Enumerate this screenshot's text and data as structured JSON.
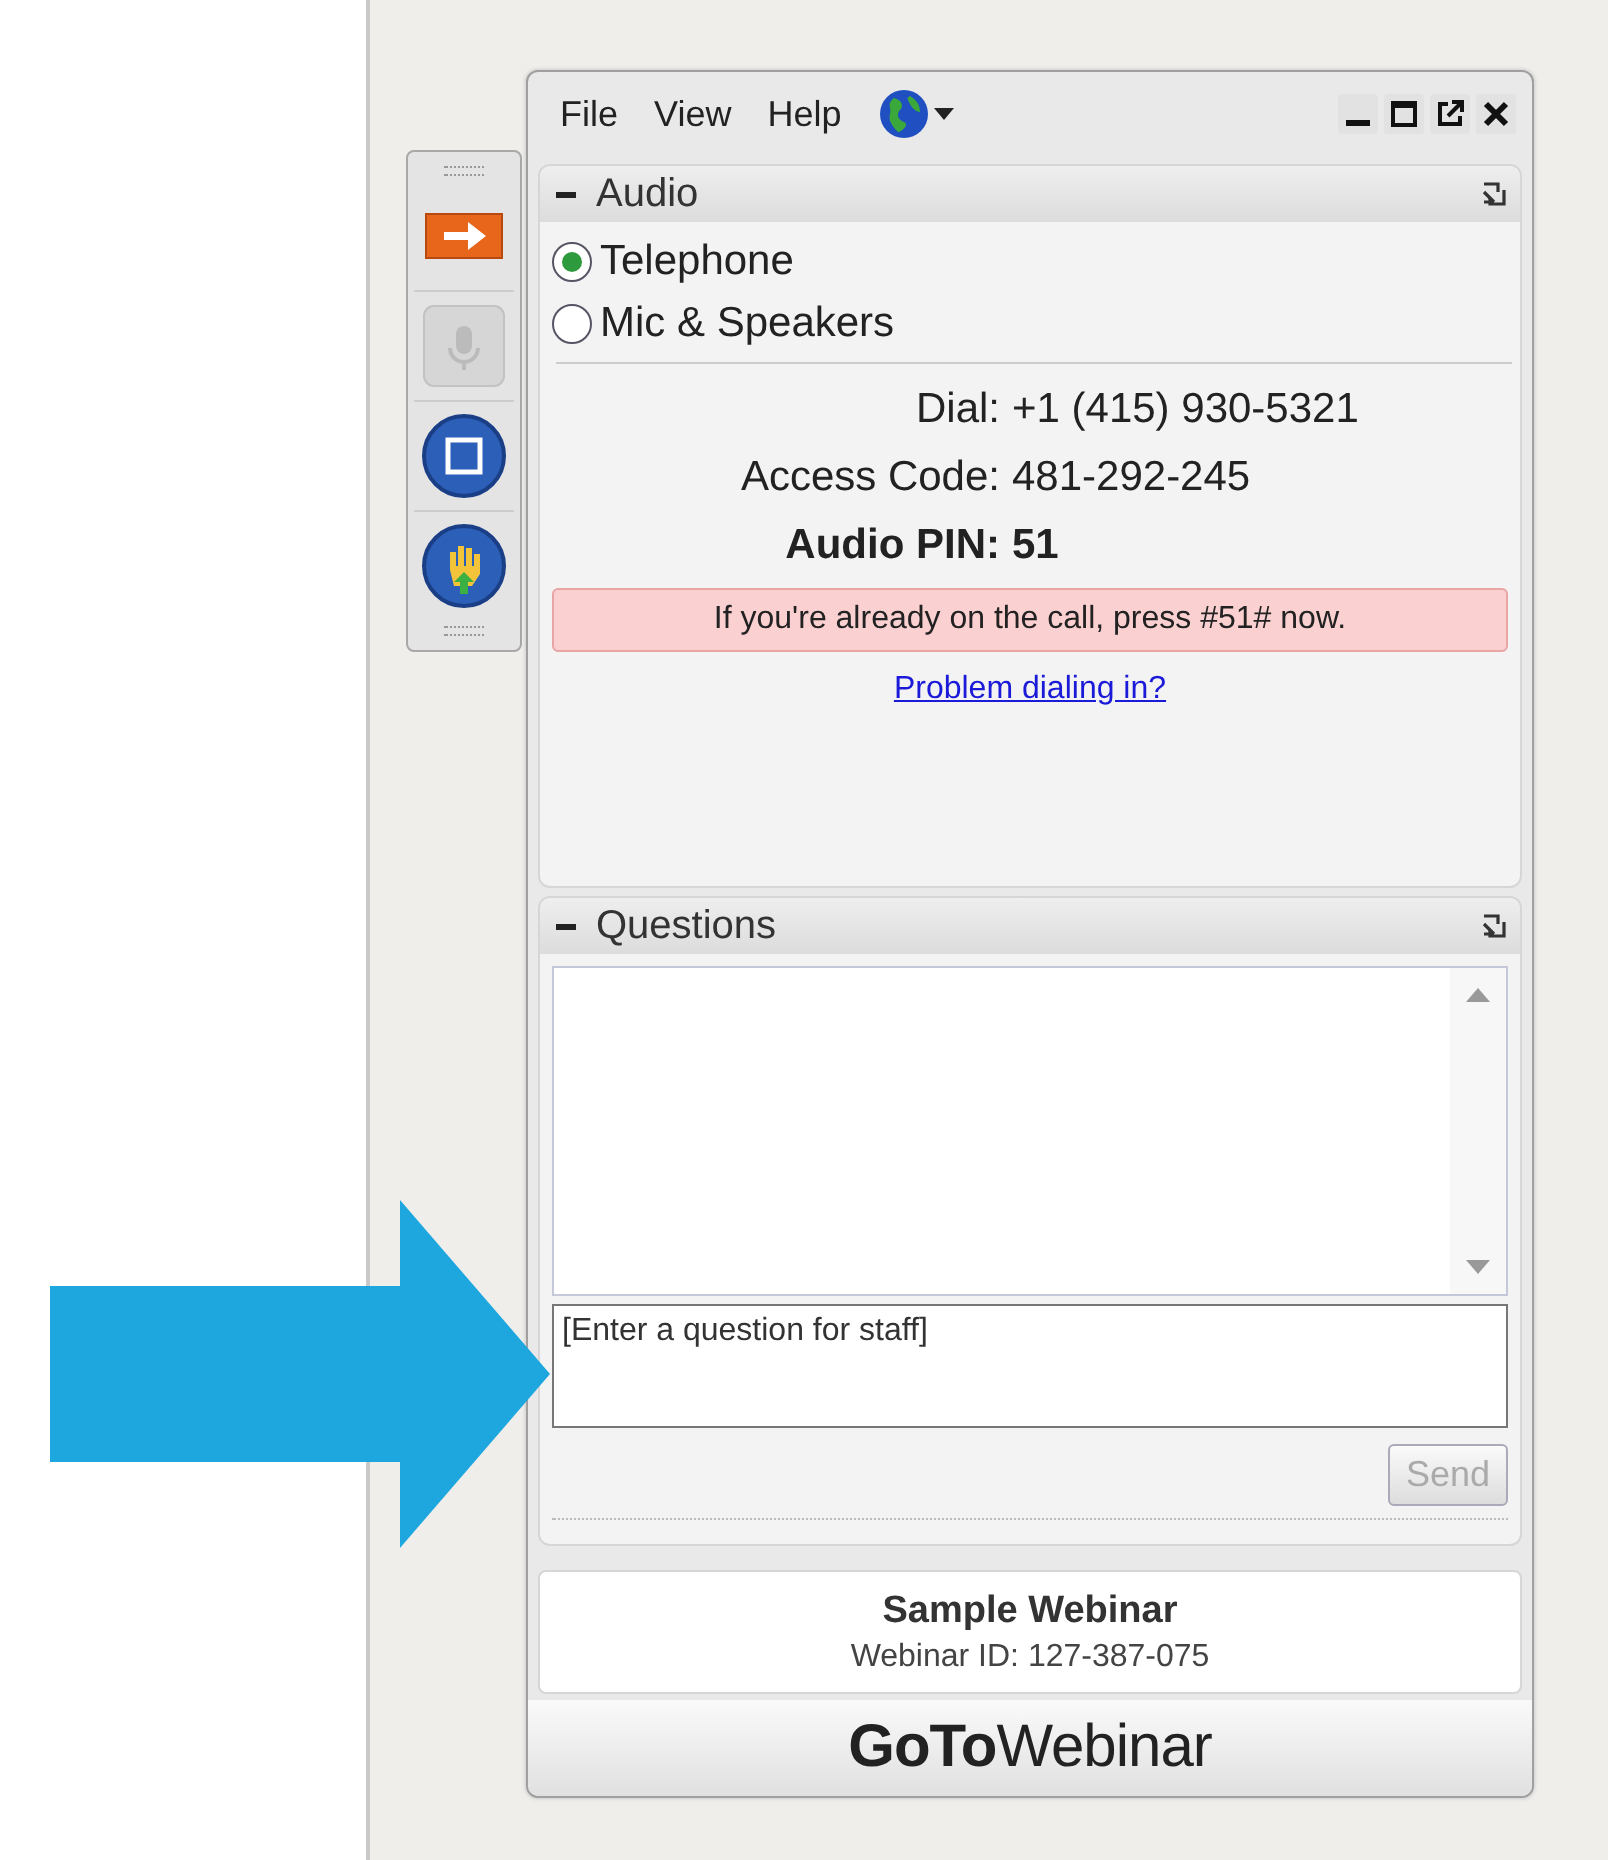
{
  "menu": [
    "File",
    "View",
    "Help"
  ],
  "audio": {
    "title": "Audio",
    "options": [
      {
        "label": "Telephone",
        "selected": true
      },
      {
        "label": "Mic & Speakers",
        "selected": false
      }
    ],
    "details": [
      {
        "label": "Dial:",
        "value": "+1 (415) 930-5321",
        "bold": false
      },
      {
        "label": "Access Code:",
        "value": "481-292-245",
        "bold": false
      },
      {
        "label": "Audio PIN:",
        "value": "51",
        "bold": true
      }
    ],
    "notice": "If you're already on the call, press #51# now.",
    "link": "Problem dialing in?"
  },
  "questions": {
    "title": "Questions",
    "placeholder": "[Enter a question for staff]",
    "send": {
      "label": "Send",
      "disabled": true
    }
  },
  "webinar": {
    "name": "Sample Webinar",
    "id": "Webinar ID: 127-387-075"
  },
  "logo": "**GoTo**Webinar"
}
